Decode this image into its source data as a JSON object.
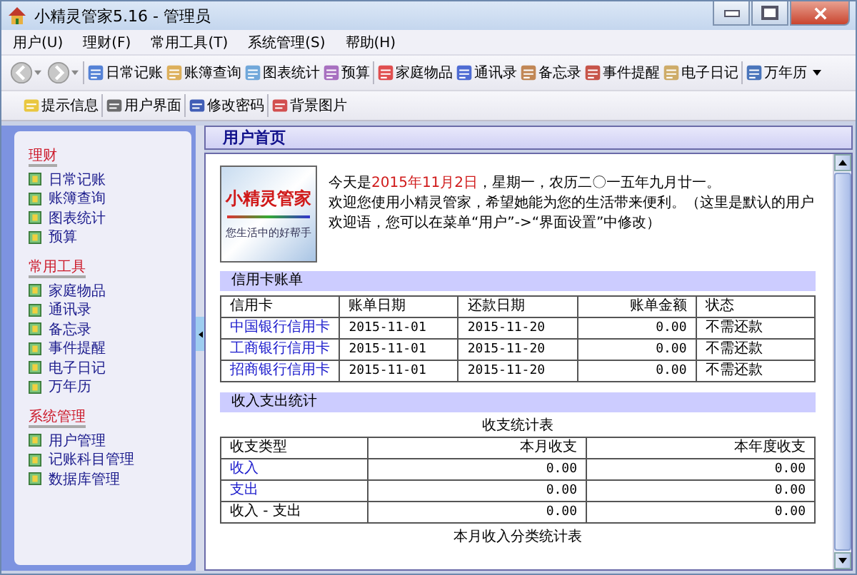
{
  "window": {
    "title": "小精灵管家5.16  -  管理员"
  },
  "menu": [
    "用户(U)",
    "理财(F)",
    "常用工具(T)",
    "系统管理(S)",
    "帮助(H)"
  ],
  "toolbar_1": [
    {
      "label": "日常记账",
      "kind": "button"
    },
    {
      "label": "账簿查询",
      "kind": "button"
    },
    {
      "label": "图表统计",
      "kind": "button"
    },
    {
      "label": "预算",
      "kind": "button"
    },
    {
      "label": "家庭物品",
      "kind": "button"
    },
    {
      "label": "通讯录",
      "kind": "button"
    },
    {
      "label": "备忘录",
      "kind": "button"
    },
    {
      "label": "事件提醒",
      "kind": "button"
    },
    {
      "label": "电子日记",
      "kind": "button"
    },
    {
      "label": "万年历",
      "kind": "dropdown"
    }
  ],
  "toolbar_2": [
    {
      "label": "提示信息"
    },
    {
      "label": "用户界面"
    },
    {
      "label": "修改密码"
    },
    {
      "label": "背景图片"
    }
  ],
  "sidebar": [
    {
      "title": "理财",
      "items": [
        "日常记账",
        "账簿查询",
        "图表统计",
        "预算"
      ]
    },
    {
      "title": "常用工具",
      "items": [
        "家庭物品",
        "通讯录",
        "备忘录",
        "事件提醒",
        "电子日记",
        "万年历"
      ]
    },
    {
      "title": "系统管理",
      "items": [
        "用户管理",
        "记账科目管理",
        "数据库管理"
      ]
    }
  ],
  "page": {
    "title": "用户首页",
    "logo": {
      "name": "小精灵管家",
      "tagline": "您生活中的好帮手"
    },
    "greeting": {
      "prefix": "今天是",
      "date": "2015年11月2日",
      "suffix": "，星期一，农历二〇一五年九月廿一。"
    },
    "welcome": "欢迎您使用小精灵管家，希望她能为您的生活带来便利。（这里是默认的用户欢迎语，您可以在菜单“用户”->“界面设置”中修改）",
    "credit_cards": {
      "title": "信用卡账单",
      "columns": [
        "信用卡",
        "账单日期",
        "还款日期",
        "账单金额",
        "状态"
      ],
      "rows": [
        {
          "link": true,
          "cells": [
            "中国银行信用卡",
            "2015-11-01",
            "2015-11-20",
            "0.00",
            "不需还款"
          ]
        },
        {
          "link": true,
          "cells": [
            "工商银行信用卡",
            "2015-11-01",
            "2015-11-20",
            "0.00",
            "不需还款"
          ]
        },
        {
          "link": true,
          "cells": [
            "招商银行信用卡",
            "2015-11-01",
            "2015-11-20",
            "0.00",
            "不需还款"
          ]
        }
      ]
    },
    "income_expense": {
      "title": "收入支出统计",
      "table_title": "收支统计表",
      "columns": [
        "收支类型",
        "本月收支",
        "本年度收支"
      ],
      "rows": [
        {
          "link": true,
          "cells": [
            "收入",
            "0.00",
            "0.00"
          ]
        },
        {
          "link": true,
          "cells": [
            "支出",
            "0.00",
            "0.00"
          ]
        },
        {
          "link": false,
          "cells": [
            "收入 - 支出",
            "0.00",
            "0.00"
          ]
        }
      ]
    },
    "next_table_title": "本月收入分类统计表"
  }
}
